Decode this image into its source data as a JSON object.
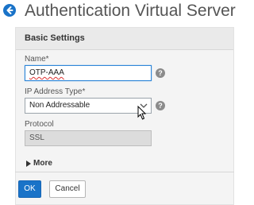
{
  "header": {
    "title": "Authentication Virtual Server",
    "back_icon": "back-arrow-icon"
  },
  "section": {
    "title": "Basic Settings"
  },
  "form": {
    "name_label": "Name*",
    "name_value": "OTP-AAA",
    "ip_label": "IP Address Type*",
    "ip_selected": "Non Addressable",
    "protocol_label": "Protocol",
    "protocol_value": "SSL",
    "help_glyph": "?"
  },
  "more_label": "More",
  "buttons": {
    "ok": "OK",
    "cancel": "Cancel"
  },
  "colors": {
    "accent": "#1a73c8",
    "help": "#8b8b8b",
    "panel": "#f4f4f4"
  }
}
